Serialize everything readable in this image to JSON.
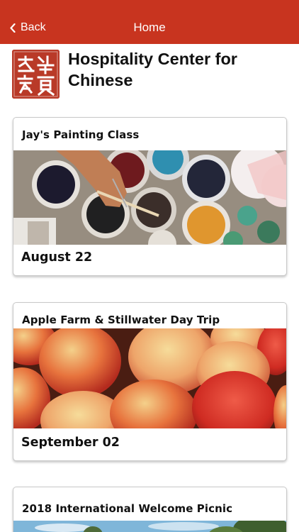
{
  "nav": {
    "back_label": "Back",
    "title": "Home",
    "color": "#c8341f"
  },
  "header": {
    "organization_name": "Hospitality Center for Chinese",
    "logo_icon": "red-seal-logo",
    "logo_text": "之华家夏"
  },
  "events": [
    {
      "title": "Jay's Painting Class",
      "date": "August 22",
      "image": "paint-cans-photo"
    },
    {
      "title": "Apple Farm & Stillwater Day Trip",
      "date": "September 02",
      "image": "apples-photo"
    },
    {
      "title": "2018 International Welcome Picnic",
      "date": "",
      "image": "outdoor-photo"
    }
  ]
}
